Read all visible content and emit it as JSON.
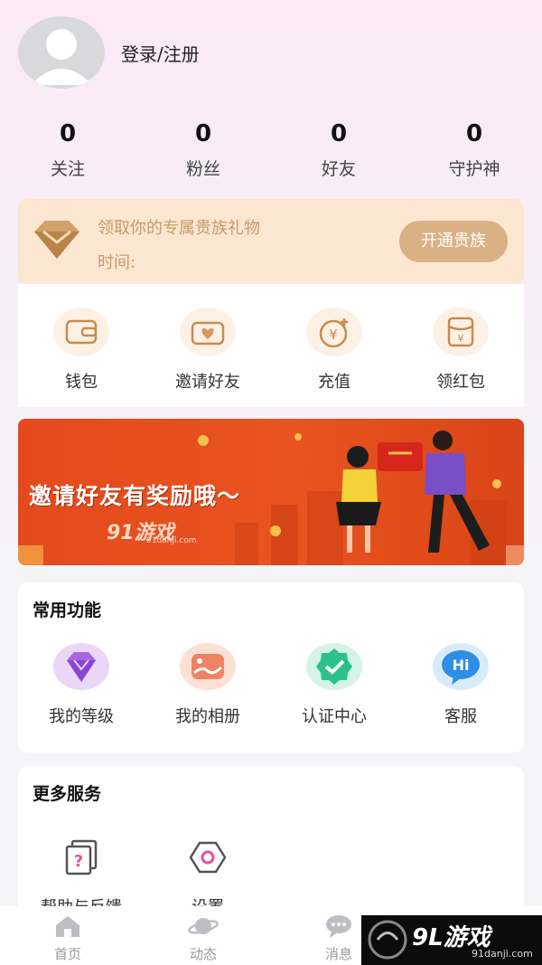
{
  "profile": {
    "login_label": "登录/注册"
  },
  "stats": [
    {
      "value": "0",
      "label": "关注"
    },
    {
      "value": "0",
      "label": "粉丝"
    },
    {
      "value": "0",
      "label": "好友"
    },
    {
      "value": "0",
      "label": "守护神"
    }
  ],
  "vip": {
    "title": "领取你的专属贵族礼物",
    "time_label": "时间:",
    "button_label": "开通贵族"
  },
  "quick_actions": [
    {
      "label": "钱包",
      "icon": "wallet-icon"
    },
    {
      "label": "邀请好友",
      "icon": "invite-icon"
    },
    {
      "label": "充值",
      "icon": "recharge-icon"
    },
    {
      "label": "领红包",
      "icon": "red-packet-icon"
    }
  ],
  "banner": {
    "text": "邀请好友有奖励哦～",
    "logo": "91游戏",
    "logo_sub": "91danji.com"
  },
  "common_functions": {
    "title": "常用功能",
    "items": [
      {
        "label": "我的等级",
        "icon": "diamond-icon"
      },
      {
        "label": "我的相册",
        "icon": "album-icon"
      },
      {
        "label": "认证中心",
        "icon": "verify-icon"
      },
      {
        "label": "客服",
        "icon": "hi-chat-icon"
      }
    ]
  },
  "more_services": {
    "title": "更多服务",
    "items": [
      {
        "label": "帮助与反馈",
        "icon": "help-icon"
      },
      {
        "label": "设置",
        "icon": "settings-icon"
      }
    ]
  },
  "tabbar": [
    {
      "label": "首页",
      "icon": "home-icon"
    },
    {
      "label": "动态",
      "icon": "planet-icon"
    },
    {
      "label": "消息",
      "icon": "message-icon"
    },
    {
      "label": "",
      "icon": "profile-icon"
    }
  ],
  "watermark": {
    "main": "9L游戏",
    "sub": "91danji.com"
  },
  "colors": {
    "accent_gold": "#d9b185",
    "vip_bg": "#fbe6d2",
    "banner_red": "#e44a1e"
  }
}
